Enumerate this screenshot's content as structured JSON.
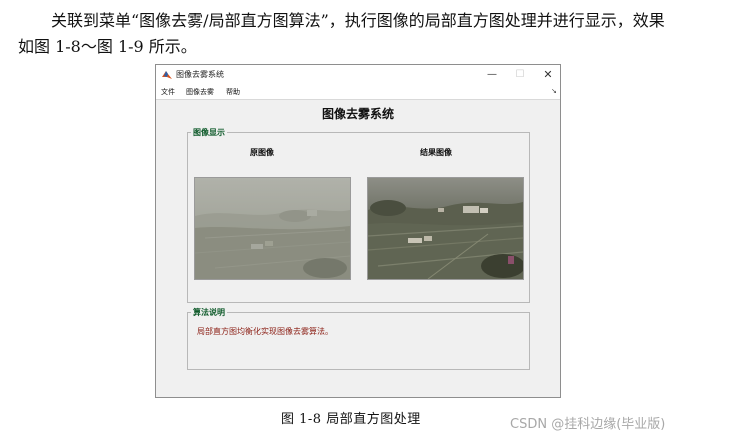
{
  "document": {
    "line1": "关联到菜单“图像去雾/局部直方图算法”，执行图像的局部直方图处理并进行显示，效果",
    "line2": "如图 1-8～图 1-9 所示。",
    "caption": "图 1-8    局部直方图处理",
    "watermark": "CSDN @挂科边缘(毕业版)"
  },
  "window": {
    "title": "图像去雾系统",
    "icon": "matlab-icon",
    "controls": {
      "minimize": "—",
      "maximize": "☐",
      "close": "✕"
    },
    "menu": [
      "文件",
      "图像去雾",
      "帮助"
    ],
    "dock_arrow": "↘",
    "system_title": "图像去雾系统",
    "display_group": {
      "title": "图像显示",
      "original_label": "原图像",
      "result_label": "结果图像"
    },
    "algo_group": {
      "title": "算法说明",
      "text": "局部直方图均衡化实现图像去雾算法。"
    }
  },
  "colors": {
    "group_title": "#0e5a2a",
    "algo_text": "#8a1c12",
    "window_bg": "#f0f0f0"
  }
}
